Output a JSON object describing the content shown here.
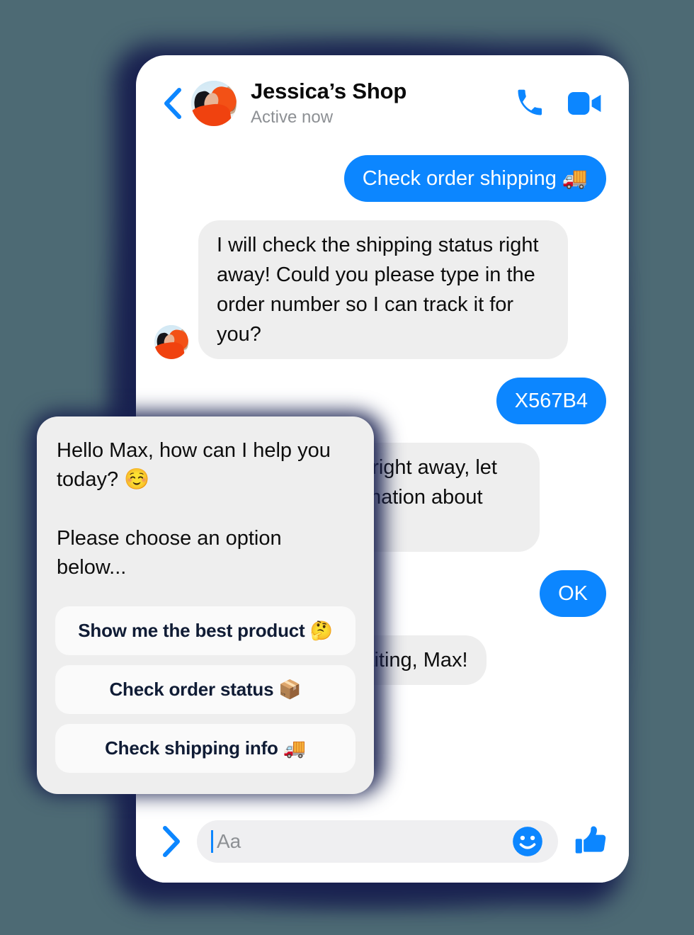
{
  "theme": {
    "page_background": "#4d6a74",
    "shadow": "#18204f",
    "accent_blue": "#0c86ff",
    "bubble_in": "#eeeeee",
    "card_background": "#eeeeee",
    "option_background": "#fafafa",
    "option_text": "#101c35",
    "status_text": "#8d9094"
  },
  "header": {
    "back_icon": "chevron-left-icon",
    "avatar_alt": "Jessica profile photo",
    "title": "Jessica’s Shop",
    "status": "Active now",
    "call_icon": "phone-icon",
    "video_icon": "video-camera-icon"
  },
  "messages": [
    {
      "direction": "out",
      "text": "Check order shipping 🚚",
      "avatar": false
    },
    {
      "direction": "in",
      "text": "I will check the shipping status right away! Could you please type in the order number so I can track it for you?",
      "avatar": true
    },
    {
      "direction": "out",
      "text": "X567B4",
      "avatar": false
    },
    {
      "direction": "in",
      "text": "I will be with you right away, let me find the information about your shipping. ⌛",
      "avatar": false
    },
    {
      "direction": "out",
      "text": "OK",
      "avatar": false
    },
    {
      "direction": "in",
      "text": "Thank you for waiting, Max!",
      "avatar": false
    }
  ],
  "composer": {
    "more_icon": "chevron-right-icon",
    "input_value": "",
    "input_placeholder": "Aa",
    "emoji_icon": "smiley-face-icon",
    "like_icon": "thumbs-up-icon"
  },
  "options_card": {
    "greeting": "Hello Max, how can I help you today? ☺️\n\nPlease choose an option below...",
    "options": [
      {
        "label": "Show me the best product 🤔"
      },
      {
        "label": "Check order status 📦"
      },
      {
        "label": "Check shipping info 🚚"
      }
    ]
  }
}
